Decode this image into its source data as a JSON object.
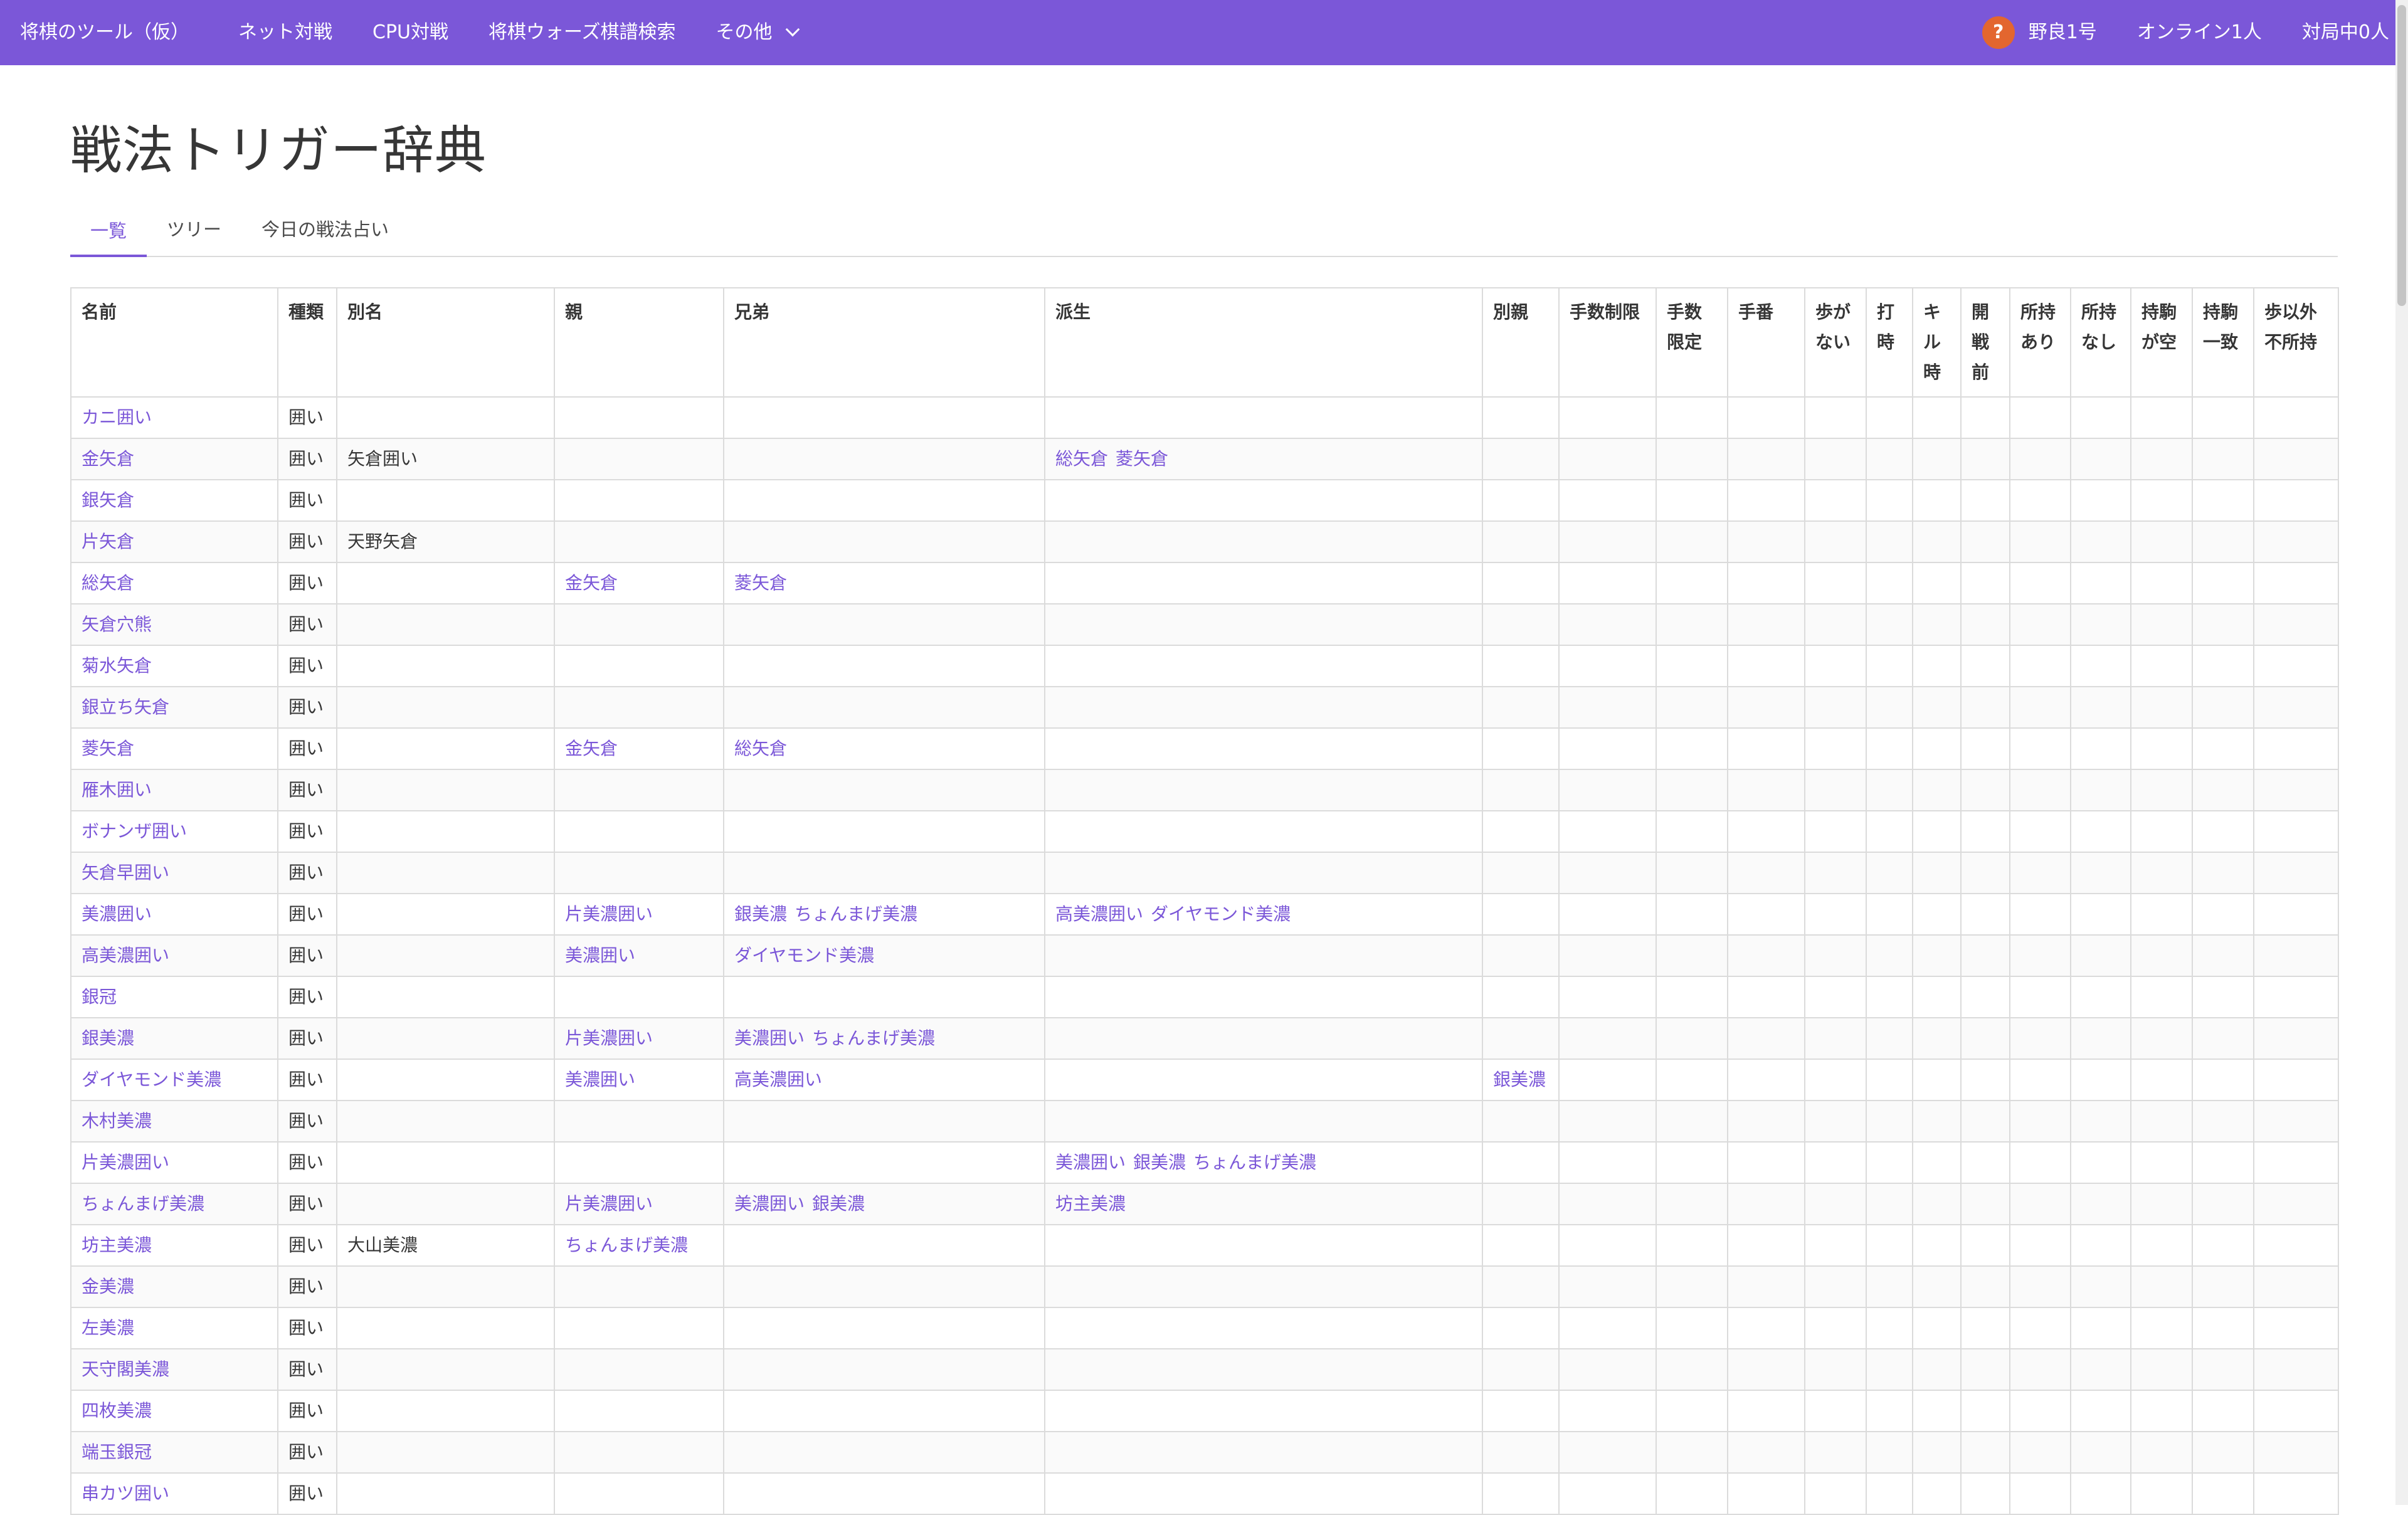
{
  "nav": {
    "brand": "将棋のツール（仮）",
    "items": [
      "ネット対戦",
      "CPU対戦",
      "将棋ウォーズ棋譜検索"
    ],
    "more": "その他",
    "help_glyph": "?",
    "user": "野良1号",
    "online": "オンライン1人",
    "playing": "対局中0人"
  },
  "page": {
    "title": "戦法トリガー辞典"
  },
  "tabs": [
    {
      "label": "一覧",
      "active": true
    },
    {
      "label": "ツリー",
      "active": false
    },
    {
      "label": "今日の戦法占い",
      "active": false
    }
  ],
  "table": {
    "headers": [
      "名前",
      "種類",
      "別名",
      "親",
      "兄弟",
      "派生",
      "別親",
      "手数制限",
      "手数限定",
      "手番",
      "歩がない",
      "打時",
      "キル時",
      "開戦前",
      "所持あり",
      "所持なし",
      "持駒が空",
      "持駒一致",
      "歩以外不所持"
    ],
    "rows": [
      {
        "name": "カニ囲い",
        "kind": "囲い",
        "alias": "",
        "parent": [],
        "siblings": [],
        "derived": [],
        "alt_parent": []
      },
      {
        "name": "金矢倉",
        "kind": "囲い",
        "alias": "矢倉囲い",
        "parent": [],
        "siblings": [],
        "derived": [
          "総矢倉",
          "菱矢倉"
        ],
        "alt_parent": []
      },
      {
        "name": "銀矢倉",
        "kind": "囲い",
        "alias": "",
        "parent": [],
        "siblings": [],
        "derived": [],
        "alt_parent": []
      },
      {
        "name": "片矢倉",
        "kind": "囲い",
        "alias": "天野矢倉",
        "parent": [],
        "siblings": [],
        "derived": [],
        "alt_parent": []
      },
      {
        "name": "総矢倉",
        "kind": "囲い",
        "alias": "",
        "parent": [
          "金矢倉"
        ],
        "siblings": [
          "菱矢倉"
        ],
        "derived": [],
        "alt_parent": []
      },
      {
        "name": "矢倉穴熊",
        "kind": "囲い",
        "alias": "",
        "parent": [],
        "siblings": [],
        "derived": [],
        "alt_parent": []
      },
      {
        "name": "菊水矢倉",
        "kind": "囲い",
        "alias": "",
        "parent": [],
        "siblings": [],
        "derived": [],
        "alt_parent": []
      },
      {
        "name": "銀立ち矢倉",
        "kind": "囲い",
        "alias": "",
        "parent": [],
        "siblings": [],
        "derived": [],
        "alt_parent": []
      },
      {
        "name": "菱矢倉",
        "kind": "囲い",
        "alias": "",
        "parent": [
          "金矢倉"
        ],
        "siblings": [
          "総矢倉"
        ],
        "derived": [],
        "alt_parent": []
      },
      {
        "name": "雁木囲い",
        "kind": "囲い",
        "alias": "",
        "parent": [],
        "siblings": [],
        "derived": [],
        "alt_parent": []
      },
      {
        "name": "ボナンザ囲い",
        "kind": "囲い",
        "alias": "",
        "parent": [],
        "siblings": [],
        "derived": [],
        "alt_parent": []
      },
      {
        "name": "矢倉早囲い",
        "kind": "囲い",
        "alias": "",
        "parent": [],
        "siblings": [],
        "derived": [],
        "alt_parent": []
      },
      {
        "name": "美濃囲い",
        "kind": "囲い",
        "alias": "",
        "parent": [
          "片美濃囲い"
        ],
        "siblings": [
          "銀美濃",
          "ちょんまげ美濃"
        ],
        "derived": [
          "高美濃囲い",
          "ダイヤモンド美濃"
        ],
        "alt_parent": []
      },
      {
        "name": "高美濃囲い",
        "kind": "囲い",
        "alias": "",
        "parent": [
          "美濃囲い"
        ],
        "siblings": [
          "ダイヤモンド美濃"
        ],
        "derived": [],
        "alt_parent": []
      },
      {
        "name": "銀冠",
        "kind": "囲い",
        "alias": "",
        "parent": [],
        "siblings": [],
        "derived": [],
        "alt_parent": []
      },
      {
        "name": "銀美濃",
        "kind": "囲い",
        "alias": "",
        "parent": [
          "片美濃囲い"
        ],
        "siblings": [
          "美濃囲い",
          "ちょんまげ美濃"
        ],
        "derived": [],
        "alt_parent": []
      },
      {
        "name": "ダイヤモンド美濃",
        "kind": "囲い",
        "alias": "",
        "parent": [
          "美濃囲い"
        ],
        "siblings": [
          "高美濃囲い"
        ],
        "derived": [],
        "alt_parent": [
          "銀美濃"
        ]
      },
      {
        "name": "木村美濃",
        "kind": "囲い",
        "alias": "",
        "parent": [],
        "siblings": [],
        "derived": [],
        "alt_parent": []
      },
      {
        "name": "片美濃囲い",
        "kind": "囲い",
        "alias": "",
        "parent": [],
        "siblings": [],
        "derived": [
          "美濃囲い",
          "銀美濃",
          "ちょんまげ美濃"
        ],
        "alt_parent": []
      },
      {
        "name": "ちょんまげ美濃",
        "kind": "囲い",
        "alias": "",
        "parent": [
          "片美濃囲い"
        ],
        "siblings": [
          "美濃囲い",
          "銀美濃"
        ],
        "derived": [
          "坊主美濃"
        ],
        "alt_parent": []
      },
      {
        "name": "坊主美濃",
        "kind": "囲い",
        "alias": "大山美濃",
        "parent": [
          "ちょんまげ美濃"
        ],
        "siblings": [],
        "derived": [],
        "alt_parent": []
      },
      {
        "name": "金美濃",
        "kind": "囲い",
        "alias": "",
        "parent": [],
        "siblings": [],
        "derived": [],
        "alt_parent": []
      },
      {
        "name": "左美濃",
        "kind": "囲い",
        "alias": "",
        "parent": [],
        "siblings": [],
        "derived": [],
        "alt_parent": []
      },
      {
        "name": "天守閣美濃",
        "kind": "囲い",
        "alias": "",
        "parent": [],
        "siblings": [],
        "derived": [],
        "alt_parent": []
      },
      {
        "name": "四枚美濃",
        "kind": "囲い",
        "alias": "",
        "parent": [],
        "siblings": [],
        "derived": [],
        "alt_parent": []
      },
      {
        "name": "端玉銀冠",
        "kind": "囲い",
        "alias": "",
        "parent": [],
        "siblings": [],
        "derived": [],
        "alt_parent": []
      },
      {
        "name": "串カツ囲い",
        "kind": "囲い",
        "alias": "",
        "parent": [],
        "siblings": [],
        "derived": [],
        "alt_parent": []
      }
    ]
  },
  "colors": {
    "accent": "#7b57d8",
    "help_badge": "#e3662f",
    "border": "#dbdbdb",
    "stripe": "#fafafa"
  }
}
